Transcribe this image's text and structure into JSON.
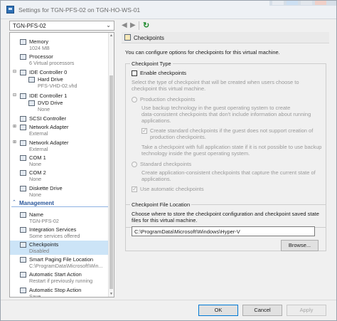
{
  "window": {
    "title": "Settings for TGN-PFS-02 on TGN-HO-WS-01",
    "icon": "hyper-v-settings-icon"
  },
  "host_selector": {
    "value": "TGN-PFS-02",
    "icon": "chevron-down-icon"
  },
  "toolbar": {
    "back_icon": "back-arrow-icon",
    "forward_icon": "forward-arrow-icon",
    "refresh_icon": "refresh-icon"
  },
  "tree": {
    "hardware": [
      {
        "name": "Memory",
        "sub": "1024 MB",
        "icon": "memory-icon"
      },
      {
        "name": "Processor",
        "sub": "6 Virtual processors",
        "icon": "processor-icon"
      },
      {
        "name": "IDE Controller 0",
        "sub": "",
        "icon": "ide-controller-icon"
      },
      {
        "name": "Hard Drive",
        "sub": "PFS-VHD-02.vhd",
        "icon": "hard-drive-icon"
      },
      {
        "name": "IDE Controller 1",
        "sub": "",
        "icon": "ide-controller-icon"
      },
      {
        "name": "DVD Drive",
        "sub": "None",
        "icon": "dvd-drive-icon"
      },
      {
        "name": "SCSI Controller",
        "sub": "",
        "icon": "scsi-controller-icon"
      },
      {
        "name": "Network Adapter",
        "sub": "External",
        "icon": "network-adapter-icon"
      },
      {
        "name": "Network Adapter",
        "sub": "External",
        "icon": "network-adapter-icon"
      },
      {
        "name": "COM 1",
        "sub": "None",
        "icon": "com-port-icon"
      },
      {
        "name": "COM 2",
        "sub": "None",
        "icon": "com-port-icon"
      },
      {
        "name": "Diskette Drive",
        "sub": "None",
        "icon": "diskette-drive-icon"
      }
    ],
    "management_label": "Management",
    "management": [
      {
        "name": "Name",
        "sub": "TGN-PFS-02",
        "icon": "name-icon"
      },
      {
        "name": "Integration Services",
        "sub": "Some services offered",
        "icon": "integration-services-icon"
      },
      {
        "name": "Checkpoints",
        "sub": "Disabled",
        "icon": "checkpoints-icon",
        "selected": true
      },
      {
        "name": "Smart Paging File Location",
        "sub": "C:\\ProgramData\\Microsoft\\Win...",
        "icon": "smart-paging-icon"
      },
      {
        "name": "Automatic Start Action",
        "sub": "Restart if previously running",
        "icon": "automatic-start-icon"
      },
      {
        "name": "Automatic Stop Action",
        "sub": "Save",
        "icon": "automatic-stop-icon"
      }
    ]
  },
  "panel": {
    "header": "Checkpoints",
    "intro": "You can configure options for checkpoints for this virtual machine.",
    "type_group": {
      "title": "Checkpoint Type",
      "enable_label": "Enable checkpoints",
      "enable_checked": false,
      "select_text": [
        "Select the type of checkpoint that will be created when users choose to",
        "checkpoint this virtual machine."
      ],
      "production_label": "Production checkpoints",
      "production_desc": [
        "Use backup technology in the guest operating system to create",
        "data-consistent checkpoints that don't include information about running",
        "applications."
      ],
      "standard_fallback_label": [
        "Create standard checkpoints if the guest does not support creation of",
        "production checkpoints."
      ],
      "take_text": [
        "Take a checkpoint with full application state if it is not possible to use backup",
        "technology inside the guest operating system."
      ],
      "standard_label": "Standard checkpoints",
      "standard_desc": [
        "Create application-consistent checkpoints that capture the current state of",
        "applications."
      ],
      "automatic_label": "Use automatic checkpoints"
    },
    "location_group": {
      "title": "Checkpoint File Location",
      "desc": [
        "Choose where to store the checkpoint configuration and checkpoint saved state",
        "files for this virtual machine."
      ],
      "path": "C:\\ProgramData\\Microsoft\\Windows\\Hyper-V",
      "browse_label": "Browse..."
    }
  },
  "footer": {
    "ok_label": "OK",
    "cancel_label": "Cancel",
    "apply_label": "Apply"
  },
  "colors": {
    "accent": "#0078d4",
    "selection": "#cce4f7",
    "management_header": "#2b579a"
  }
}
